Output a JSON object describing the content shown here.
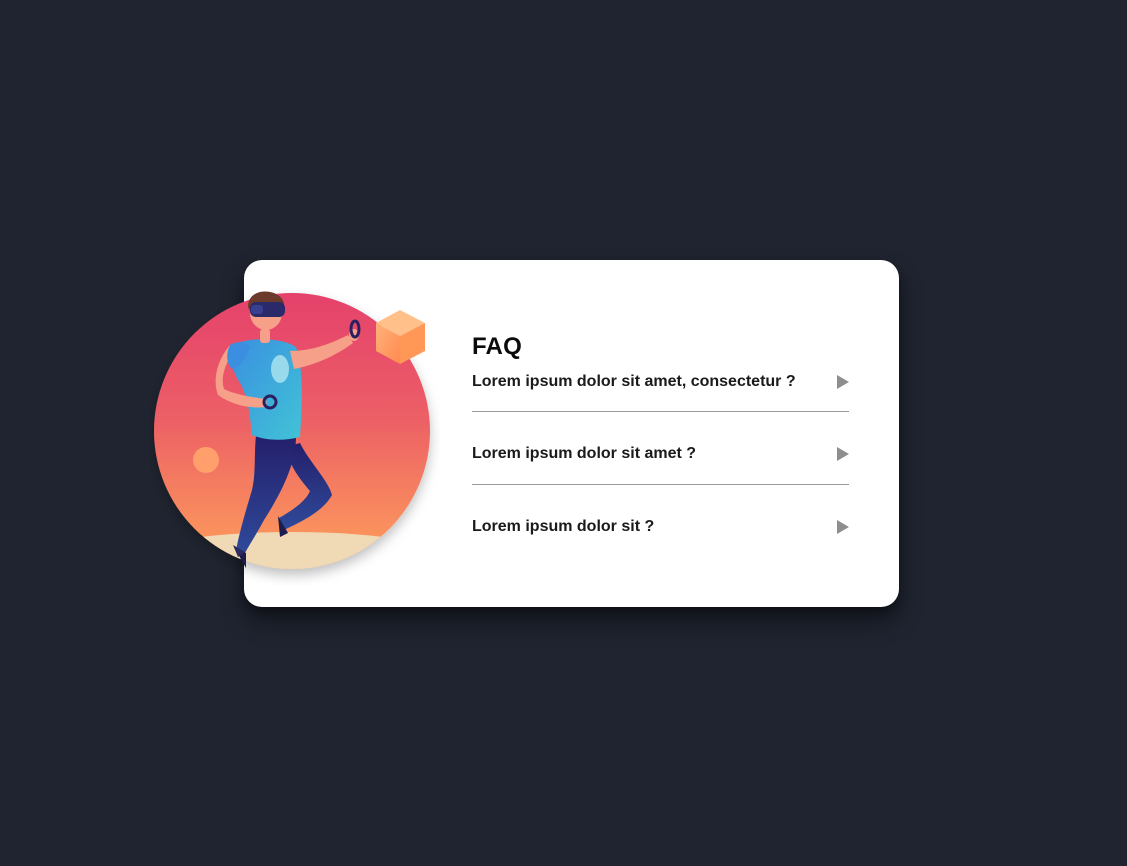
{
  "faq": {
    "title": "FAQ",
    "items": [
      {
        "question": "Lorem ipsum dolor sit amet, consectetur ?",
        "expanded": false
      },
      {
        "question": "Lorem ipsum dolor sit amet ?",
        "expanded": false
      },
      {
        "question": "Lorem ipsum dolor sit ?",
        "expanded": false
      }
    ]
  },
  "icons": {
    "arrow": "play-triangle-right-icon",
    "illustration": "vr-player-illustration"
  },
  "colors": {
    "background": "#1f2430",
    "card": "#ffffff",
    "title": "#0b0b0b",
    "question": "#1a1a1a",
    "arrow": "#8e8e8e",
    "divider": "#9a9a9a",
    "gradient_top": "#e5446d",
    "gradient_bottom": "#ff9a5a"
  }
}
